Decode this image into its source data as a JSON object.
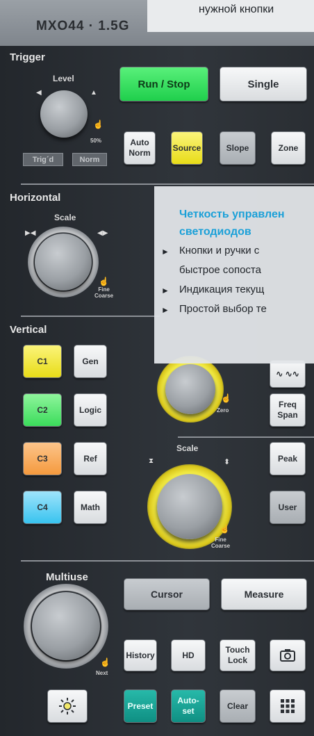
{
  "top": {
    "model": "MXO44  ·  1.5G",
    "callout_text": "нужной кнопки"
  },
  "trigger": {
    "title": "Trigger",
    "level_label": "Level",
    "pct_label": "50%",
    "trigd_label": "Trig´d",
    "norm_label": "Norm",
    "run_stop": "Run / Stop",
    "single": "Single",
    "auto_norm": "Auto\nNorm",
    "source": "Source",
    "slope": "Slope",
    "zone": "Zone"
  },
  "horizontal": {
    "title": "Horizontal",
    "scale_label": "Scale",
    "fine_coarse": "Fine\nCoarse"
  },
  "callout": {
    "title": "Четкость управлен\nсветодиодов",
    "bullets": [
      "Кнопки и ручки с",
      "быстрое сопоста",
      "Индикация текущ",
      "Простой выбор те"
    ]
  },
  "vertical": {
    "title": "Vertical",
    "c1": "C1",
    "c2": "C2",
    "c3": "C3",
    "c4": "C4",
    "gen": "Gen",
    "logic": "Logic",
    "ref": "Ref",
    "math": "Math",
    "zero_label": "Zero",
    "scale_label": "Scale",
    "fine_coarse": "Fine\nCoarse"
  },
  "spectrum": {
    "wave": "∿ ∿∿",
    "freq_span": "Freq\nSpan",
    "peak": "Peak",
    "user": "User"
  },
  "multiuse": {
    "title": "Multiuse",
    "next_label": "Next",
    "cursor": "Cursor",
    "measure": "Measure",
    "history": "History",
    "hd": "HD",
    "touch_lock": "Touch\nLock",
    "preset": "Preset",
    "autoset": "Auto-\nset",
    "clear": "Clear"
  },
  "icons": [
    "camera-icon",
    "brightness-icon",
    "apps-grid-icon",
    "finger-icon",
    "arrow-left-icon",
    "arrow-right-icon",
    "arrow-up-icon"
  ],
  "colors": {
    "green": "#2ad356",
    "yellow": "#f0e53a",
    "orange": "#f7a24a",
    "cyan": "#45c8f1",
    "teal": "#16a091",
    "callout_accent": "#1aa0d8"
  }
}
